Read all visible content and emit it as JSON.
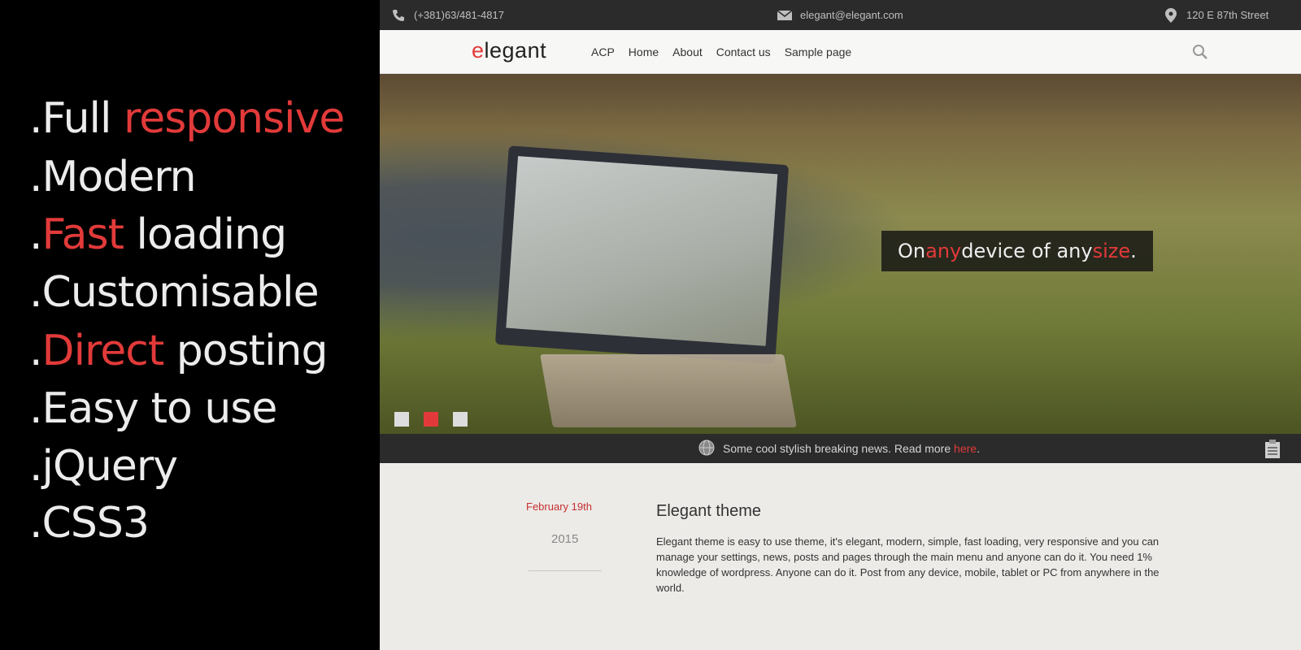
{
  "promo": {
    "features": [
      {
        "pre": ".Full ",
        "hl": "responsive",
        "post": ""
      },
      {
        "pre": ".Modern",
        "hl": "",
        "post": ""
      },
      {
        "pre": ".",
        "hl": "Fast",
        "post": " loading"
      },
      {
        "pre": ".Customisable",
        "hl": "",
        "post": ""
      },
      {
        "pre": ".",
        "hl": "Direct",
        "post": " posting"
      },
      {
        "pre": ".Easy to use",
        "hl": "",
        "post": ""
      },
      {
        "pre": ".jQuery",
        "hl": "",
        "post": ""
      },
      {
        "pre": ".CSS3",
        "hl": "",
        "post": ""
      }
    ],
    "accent_color": "#e23a3a",
    "text_color": "#ececec"
  },
  "topbar": {
    "phone": "(+381)63/481-4817",
    "email": "elegant@elegant.com",
    "address": "120 E 87th Street",
    "icons": [
      "phone-icon",
      "mail-icon",
      "location-pin-icon"
    ]
  },
  "header": {
    "logo_first": "e",
    "logo_rest": "legant",
    "nav": [
      "ACP",
      "Home",
      "About",
      "Contact us",
      "Sample page"
    ],
    "search_icon": "search-icon"
  },
  "hero": {
    "caption": {
      "p1": "On ",
      "hl1": "any",
      "p2": " device of any ",
      "hl2": "size",
      "p3": "."
    },
    "slides": 3,
    "active_slide": 2
  },
  "news": {
    "icon": "globe-icon",
    "text": "Some cool stylish breaking news. Read more ",
    "link": "here",
    "end": ".",
    "right_icon": "clipboard-icon"
  },
  "post": {
    "date": "February 19th",
    "year": "2015",
    "title": "Elegant theme",
    "body": "Elegant theme is easy to use theme, it's elegant, modern, simple, fast loading, very responsive and you can manage your settings, news, posts and pages through the main menu and anyone can do it. You need 1% knowledge of wordpress. Anyone can do it. Post from any device, mobile, tablet or PC from anywhere in the world."
  }
}
